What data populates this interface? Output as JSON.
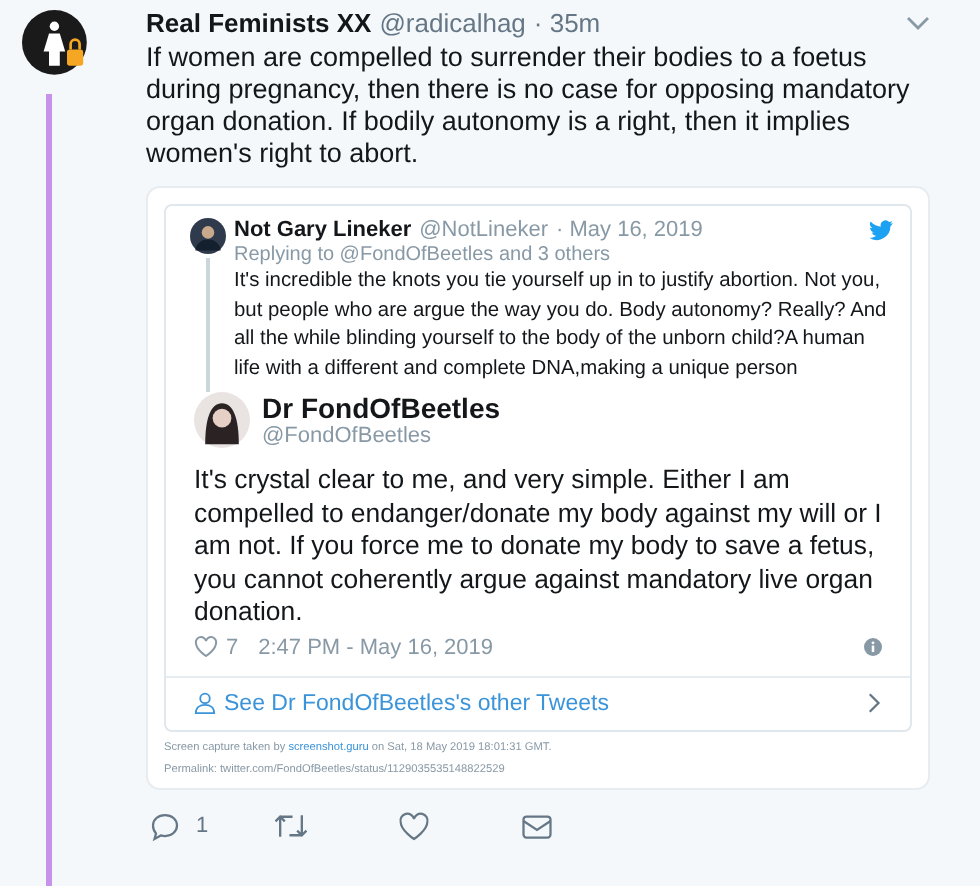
{
  "tweet": {
    "author": "Real Feminists XX",
    "handle": "@radicalhag",
    "time": "· 35m",
    "text": "If women are compelled to surrender their bodies to a foetus during pregnancy, then there is no case for opposing mandatory organ donation.  If bodily autonomy is a right, then it implies women's right to abort."
  },
  "embed": {
    "reply": {
      "author": "Not Gary Lineker",
      "handle": "@NotLineker",
      "date": "· May 16, 2019",
      "replying_to": "Replying to @FondOfBeetles and 3 others",
      "text": "It's incredible the knots you tie yourself up in to justify abortion. Not you, but people who are argue the way you do. Body autonomy? Really? And all the while blinding yourself to the body of the unborn child?A human life with a different and complete DNA,making a unique person"
    },
    "main": {
      "author": "Dr FondOfBeetles",
      "handle": "@FondOfBeetles",
      "text": "It's crystal clear to me, and very simple. Either I am compelled to endanger/donate my body against my will or I am not. If you force me to donate my body to save a fetus, you cannot coherently argue against mandatory live organ donation.",
      "likes": "7",
      "timestamp": "2:47 PM - May 16, 2019",
      "see_more": "See Dr FondOfBeetles's other Tweets"
    },
    "capture": [
      {
        "kind": "plain",
        "text": "Screen capture taken by "
      },
      {
        "kind": "link",
        "text": "screenshot.guru"
      },
      {
        "kind": "plain",
        "text": " on Sat, 18 May 2019 18:01:31 GMT."
      }
    ],
    "permalink": "Permalink: twitter.com/FondOfBeetles/status/1129035535148822529"
  },
  "actions": [
    {
      "kind": "reply",
      "count": "1"
    },
    {
      "kind": "retweet"
    },
    {
      "kind": "like"
    },
    {
      "kind": "message"
    }
  ]
}
